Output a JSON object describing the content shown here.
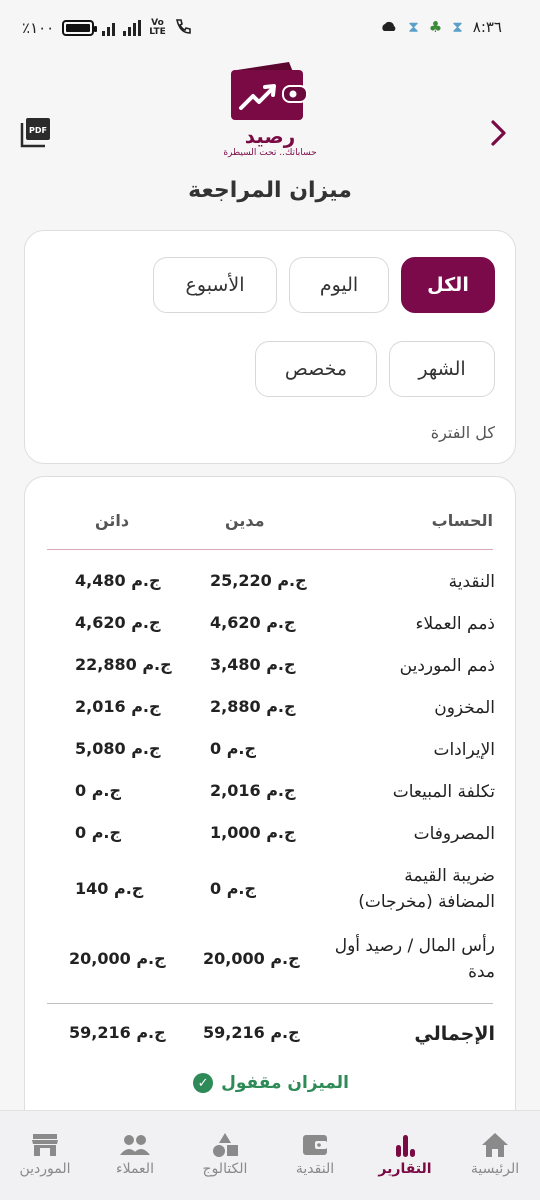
{
  "status_bar": {
    "time": "٨:٣٦",
    "battery": "٪١٠٠",
    "network": "Vo\nLTE"
  },
  "header": {
    "logo_name": "رصيد",
    "logo_tagline": "حساباتك.. تحت السيطرة",
    "page_title": "ميزان المراجعة",
    "pdf_label": "PDF"
  },
  "filters": {
    "chips": [
      {
        "label": "الكل",
        "active": true
      },
      {
        "label": "اليوم",
        "active": false
      },
      {
        "label": "الأسبوع",
        "active": false
      },
      {
        "label": "الشهر",
        "active": false
      },
      {
        "label": "مخصص",
        "active": false
      }
    ],
    "period_label": "كل الفترة"
  },
  "table": {
    "headers": {
      "account": "الحساب",
      "debit": "مدين",
      "credit": "دائن"
    },
    "rows": [
      {
        "name": "النقدية",
        "debit": "25,220 ج.م",
        "credit": "4,480 ج.م"
      },
      {
        "name": "ذمم العملاء",
        "debit": "4,620 ج.م",
        "credit": "4,620 ج.م"
      },
      {
        "name": "ذمم الموردين",
        "debit": "3,480 ج.م",
        "credit": "22,880 ج.م"
      },
      {
        "name": "المخزون",
        "debit": "2,880 ج.م",
        "credit": "2,016 ج.م"
      },
      {
        "name": "الإيرادات",
        "debit": "0 ج.م",
        "credit": "5,080 ج.م"
      },
      {
        "name": "تكلفة المبيعات",
        "debit": "2,016 ج.م",
        "credit": "0 ج.م"
      },
      {
        "name": "المصروفات",
        "debit": "1,000 ج.م",
        "credit": "0 ج.م"
      },
      {
        "name": "ضريبة القيمة المضافة (مخرجات)",
        "name_line1": "ضريبة القيمة",
        "name_line2": "المضافة (مخرجات)",
        "debit": "0 ج.م",
        "credit": "140 ج.م"
      },
      {
        "name": "رأس المال / رصيد أول مدة",
        "name_line1": "رأس المال / رصيد أول",
        "name_line2": "مدة",
        "debit": "20,000 ج.م",
        "credit": "20,000 ج.م"
      }
    ],
    "total": {
      "name": "الإجمالي",
      "debit": "59,216 ج.م",
      "credit": "59,216 ج.م"
    },
    "balance_status": "الميزان مقفول"
  },
  "bottom_nav": [
    {
      "label": "الرئيسية",
      "icon": "home-icon",
      "active": false
    },
    {
      "label": "التقارير",
      "icon": "reports-icon",
      "active": true
    },
    {
      "label": "النقدية",
      "icon": "wallet-icon",
      "active": false
    },
    {
      "label": "الكتالوج",
      "icon": "catalog-icon",
      "active": false
    },
    {
      "label": "العملاء",
      "icon": "customers-icon",
      "active": false
    },
    {
      "label": "الموردين",
      "icon": "suppliers-icon",
      "active": false
    }
  ],
  "colors": {
    "brand": "#7a0a44",
    "success": "#2e8b57"
  }
}
